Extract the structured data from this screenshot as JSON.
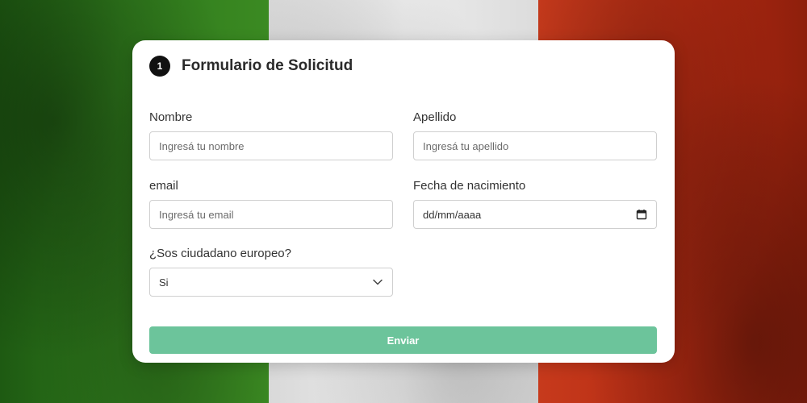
{
  "form": {
    "step_number": "1",
    "title": "Formulario de Solicitud",
    "fields": {
      "nombre": {
        "label": "Nombre",
        "placeholder": "Ingresá tu nombre"
      },
      "apellido": {
        "label": "Apellido",
        "placeholder": "Ingresá tu apellido"
      },
      "email": {
        "label": "email",
        "placeholder": "Ingresá tu email"
      },
      "fecha": {
        "label": "Fecha de nacimiento",
        "value": "dd/mm/aaaa",
        "icon": "calendar-icon"
      },
      "europeo": {
        "label": "¿Sos ciudadano europeo?",
        "value": "Si",
        "icon": "chevron-down-icon"
      }
    },
    "submit_label": "Enviar"
  },
  "colors": {
    "flag_green": "#2f7a1c",
    "flag_white": "#ececec",
    "flag_red": "#b32a12",
    "button": "#6cc49b",
    "badge": "#111111"
  }
}
